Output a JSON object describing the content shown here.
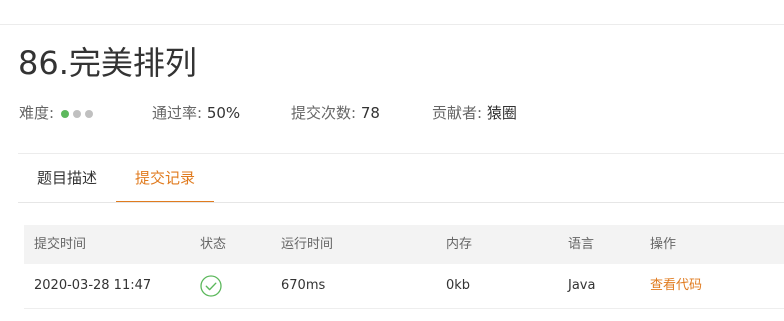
{
  "problem": {
    "title": "86.完美排列",
    "difficulty_label": "难度:",
    "difficulty_colors": [
      "#5cb85c",
      "#c0c0c0",
      "#c0c0c0"
    ],
    "pass_rate_label": "通过率:",
    "pass_rate_value": "50%",
    "submissions_label": "提交次数:",
    "submissions_value": "78",
    "contributor_label": "贡献者:",
    "contributor_value": "猿圈"
  },
  "tabs": [
    {
      "label": "题目描述",
      "active": false
    },
    {
      "label": "提交记录",
      "active": true
    }
  ],
  "table": {
    "headers": [
      "提交时间",
      "状态",
      "运行时间",
      "内存",
      "语言",
      "操作"
    ],
    "rows": [
      {
        "time": "2020-03-28 11:47",
        "status_icon": "check-circle-icon",
        "runtime": "670ms",
        "memory": "0kb",
        "language": "Java",
        "action": "查看代码"
      }
    ]
  },
  "colors": {
    "accent": "#e07b1f",
    "success": "#5cb85c"
  }
}
